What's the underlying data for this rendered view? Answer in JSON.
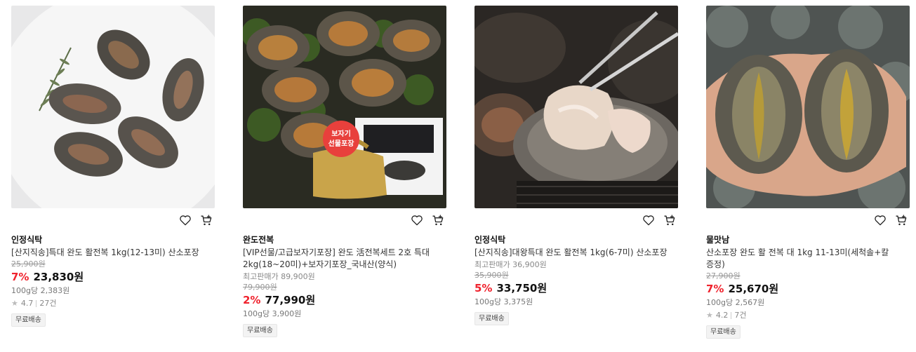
{
  "products": [
    {
      "store": "인정식탁",
      "title": "[산지직송]특대 완도 활전복 1kg(12-13미) 산소포장",
      "original_price": "25,900원",
      "discount": "7%",
      "price": "23,830원",
      "unit_price": "100g당 2,383원",
      "rating": "4.7",
      "reviews": "27건",
      "shipping": "무료배송",
      "image_icon": "abalone-plate-photo"
    },
    {
      "store": "완도전복",
      "title": "[VIP선물/고급보자기포장] 완도 活전복세트 2호 특대 2kg(18~20미)+보자기포장_국내산(양식)",
      "max_price_label": "최고판매가 89,900원",
      "original_price": "79,900원",
      "discount": "2%",
      "price": "77,990원",
      "unit_price": "100g당 3,900원",
      "shipping": "무료배송",
      "image_badge": "보자기 선물포장",
      "image_icon": "abalone-gift-set-photo"
    },
    {
      "store": "인정식탁",
      "title": "[산지직송]대왕특대 완도 활전복 1kg(6-7미) 산소포장",
      "max_price_label": "최고판매가 36,900원",
      "original_price": "35,900원",
      "discount": "5%",
      "price": "33,750원",
      "unit_price": "100g당 3,375원",
      "shipping": "무료배송",
      "image_icon": "grilled-abalone-photo"
    },
    {
      "store": "물맛남",
      "title": "산소포장 완도 활 전복 대 1kg 11-13미(세척솔+칼 증정)",
      "original_price": "27,900원",
      "discount": "7%",
      "price": "25,670원",
      "unit_price": "100g당 2,567원",
      "rating": "4.2",
      "reviews": "7건",
      "shipping": "무료배송",
      "image_icon": "abalone-in-hand-photo"
    }
  ],
  "colors": {
    "discount": "#f0232e",
    "text": "#222222",
    "muted": "#888888"
  }
}
